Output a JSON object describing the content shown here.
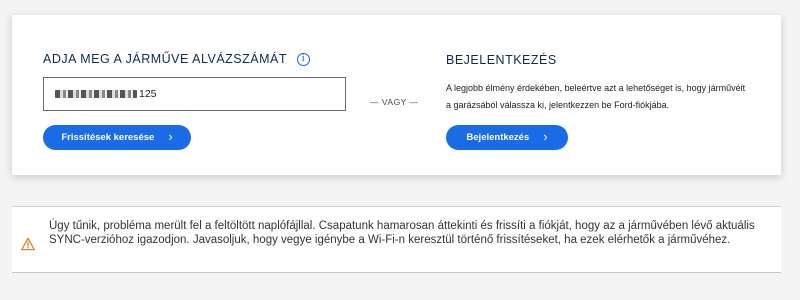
{
  "vin_section": {
    "title": "ADJA MEG A JÁRMŰVE ALVÁZSZÁMÁT",
    "info_icon": "info-icon",
    "input_visible_suffix": "125",
    "search_button_label": "Frissítések keresése"
  },
  "divider": {
    "label": "— VAGY —"
  },
  "login_section": {
    "title": "BEJELENTKEZÉS",
    "description": "A legjobb élmény érdekében, beleértve azt a lehetőséget is, hogy járművéit a garázsából válassza ki, jelentkezzen be Ford-fiókjába.",
    "login_button_label": "Bejelentkezés"
  },
  "notice": {
    "icon": "warning-icon",
    "message": "Úgy tűnik, probléma merült fel a feltöltött naplófájllal. Csapatunk hamarosan áttekinti és frissíti a fiókját, hogy az a járművében lévő aktuális SYNC-verzióhoz igazodjon. Javasoljuk, hogy vegye igénybe a Wi-Fi-n keresztül történő frissítéseket, ha ezek elérhetők a járművéhez."
  },
  "colors": {
    "accent": "#1a6be6",
    "heading": "#102b4e",
    "warning": "#d9822b"
  }
}
